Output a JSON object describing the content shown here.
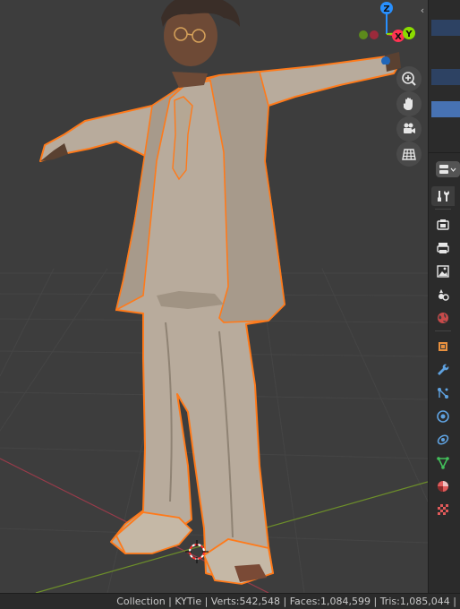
{
  "viewport": {
    "object_name": "KYTie",
    "selection_color": "#ff7a1a",
    "grid_x_axis_color": "#9a3b4a",
    "grid_y_axis_color": "#6d8f2a"
  },
  "gizmo": {
    "z_label": "Z",
    "x_label": "X",
    "y_label": "Y",
    "x_color": "#ff3352",
    "y_color": "#8bdc00",
    "z_color": "#2890ff"
  },
  "navigation_buttons": [
    "zoom-in-icon",
    "hand-pan-icon",
    "camera-icon",
    "grid-view-icon"
  ],
  "properties_tabs": [
    {
      "name": "tool-icon",
      "active": true
    },
    {
      "name": "render-icon"
    },
    {
      "name": "output-icon"
    },
    {
      "name": "view-layer-icon"
    },
    {
      "name": "scene-icon"
    },
    {
      "name": "world-icon"
    },
    {
      "name": "object-icon"
    },
    {
      "name": "modifier-icon"
    },
    {
      "name": "particles-icon"
    },
    {
      "name": "physics-icon"
    },
    {
      "name": "constraints-icon"
    },
    {
      "name": "data-icon"
    },
    {
      "name": "material-icon"
    },
    {
      "name": "texture-icon"
    }
  ],
  "status_bar": {
    "text": "Collection | KYTie | Verts:542,548 | Faces:1,084,599 | Tris:1,085,044 |"
  }
}
